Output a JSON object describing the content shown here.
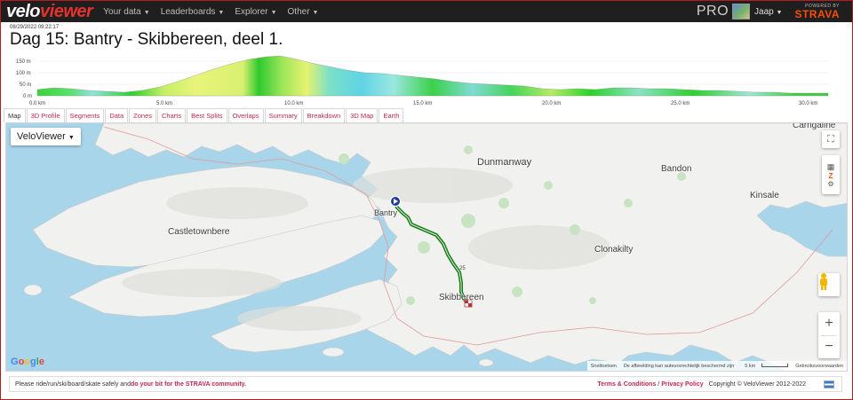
{
  "brand": {
    "logo_a": "velo",
    "logo_b": "viewer"
  },
  "nav": {
    "items": [
      {
        "label": "Your data"
      },
      {
        "label": "Leaderboards"
      },
      {
        "label": "Explorer"
      },
      {
        "label": "Other"
      }
    ],
    "pro_label": "PRO",
    "user": "Jaap",
    "powered_by": "POWERED BY",
    "strava": "STRAVA"
  },
  "activity": {
    "timestamp": "08/29/2022 09:22:17",
    "title": "Dag 15: Bantry - Skibbereen, deel 1."
  },
  "elevation": {
    "y_ticks": [
      "150 m",
      "100 m",
      "50 m",
      "0 m"
    ],
    "x_ticks": [
      "0.0 km",
      "5.0 km",
      "10.0 km",
      "15.0 km",
      "20.0 km",
      "25.0 km",
      "30.0 km"
    ]
  },
  "tabs": [
    "Map",
    "3D Profile",
    "Segments",
    "Data",
    "Zones",
    "Charts",
    "Best Splits",
    "Overlaps",
    "Summary",
    "Breakdown",
    "3D Map",
    "Earth"
  ],
  "map": {
    "type_select": "VeloViewer",
    "places": {
      "carrigaline": "Carrigaline",
      "dunmanway": "Dunmanway",
      "bandon": "Bandon",
      "kinsale": "Kinsale",
      "castletownbere": "Castletownbere",
      "bantry": "Bantry",
      "clonakilty": "Clonakilty",
      "skibbereen": "Skibbereen"
    },
    "marker_25": "25",
    "google": [
      "G",
      "o",
      "o",
      "g",
      "l",
      "e"
    ],
    "attribution": {
      "shortcuts": "Sneltoetsen",
      "copyright": "De afbeelding kan auteursrechtelijk beschermd zijn",
      "scale": "5 km",
      "terms": "Gebruiksvoorwaarden"
    },
    "zoom_in": "+",
    "zoom_out": "−",
    "accent": "#1a7a1a"
  },
  "footer": {
    "notice_a": "Please ride/run/ski/board/skate safely and ",
    "notice_b": "do your bit for the STRAVA community.",
    "terms": "Terms & Conditions",
    "sep": " / ",
    "privacy": "Privacy Policy",
    "copyright": "Copyright © VeloViewer 2012-2022"
  }
}
